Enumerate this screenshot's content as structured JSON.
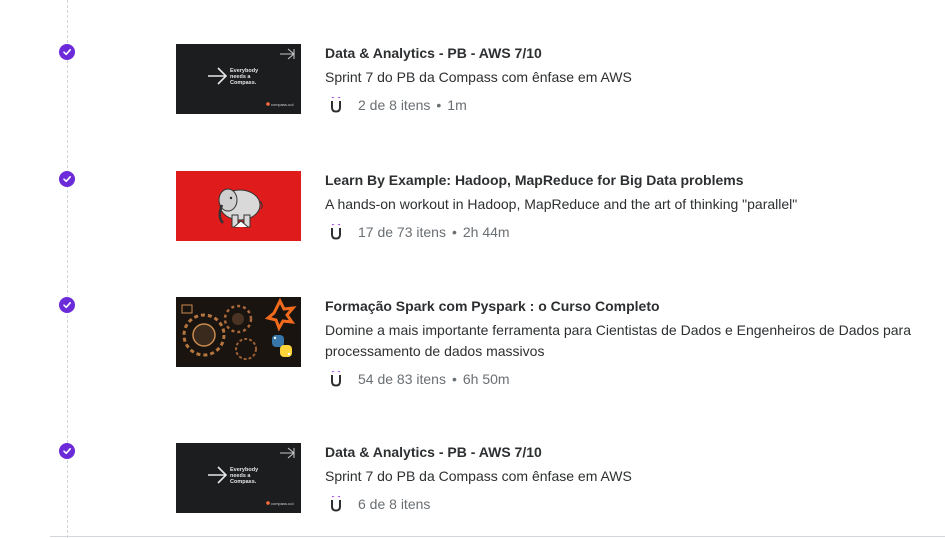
{
  "courses": [
    {
      "title": "Data & Analytics - PB - AWS 7/10",
      "description": "Sprint 7 do PB da Compass com ênfase em AWS",
      "progress": "2 de 8 itens",
      "duration": "1m",
      "thumbnail": "compass",
      "thumb_text": [
        "Everybody",
        "needs a",
        "Compass."
      ],
      "thumb_brand": "compass.uol",
      "completed": true
    },
    {
      "title": "Learn By Example: Hadoop, MapReduce for Big Data problems",
      "description": "A hands-on workout in Hadoop, MapReduce and the art of thinking \"parallel\"",
      "progress": "17 de 73 itens",
      "duration": "2h 44m",
      "thumbnail": "hadoop-elephant",
      "completed": true
    },
    {
      "title": "Formação Spark com Pyspark : o Curso Completo",
      "description": "Domine a mais importante ferramenta para Cientistas de Dados e Engenheiros de Dados para processamento de dados massivos",
      "progress": "54 de 83 itens",
      "duration": "6h 50m",
      "thumbnail": "spark-python",
      "completed": true
    },
    {
      "title": "Data & Analytics - PB - AWS 7/10",
      "description": "Sprint 7 do PB da Compass com ênfase em AWS",
      "progress": "6 de 8 itens",
      "duration": "",
      "thumbnail": "compass",
      "thumb_text": [
        "Everybody",
        "needs a",
        "Compass."
      ],
      "thumb_brand": "compass.uol",
      "completed": true
    }
  ],
  "icons": {
    "check": "check-circle-icon",
    "provider": "udemy-u-icon"
  },
  "colors": {
    "check": "#6c2bd9",
    "hadoop_bg": "#e01b1b",
    "compass_bg": "#1c1d1f",
    "meta_text": "#6a6f73"
  },
  "separator": "•"
}
